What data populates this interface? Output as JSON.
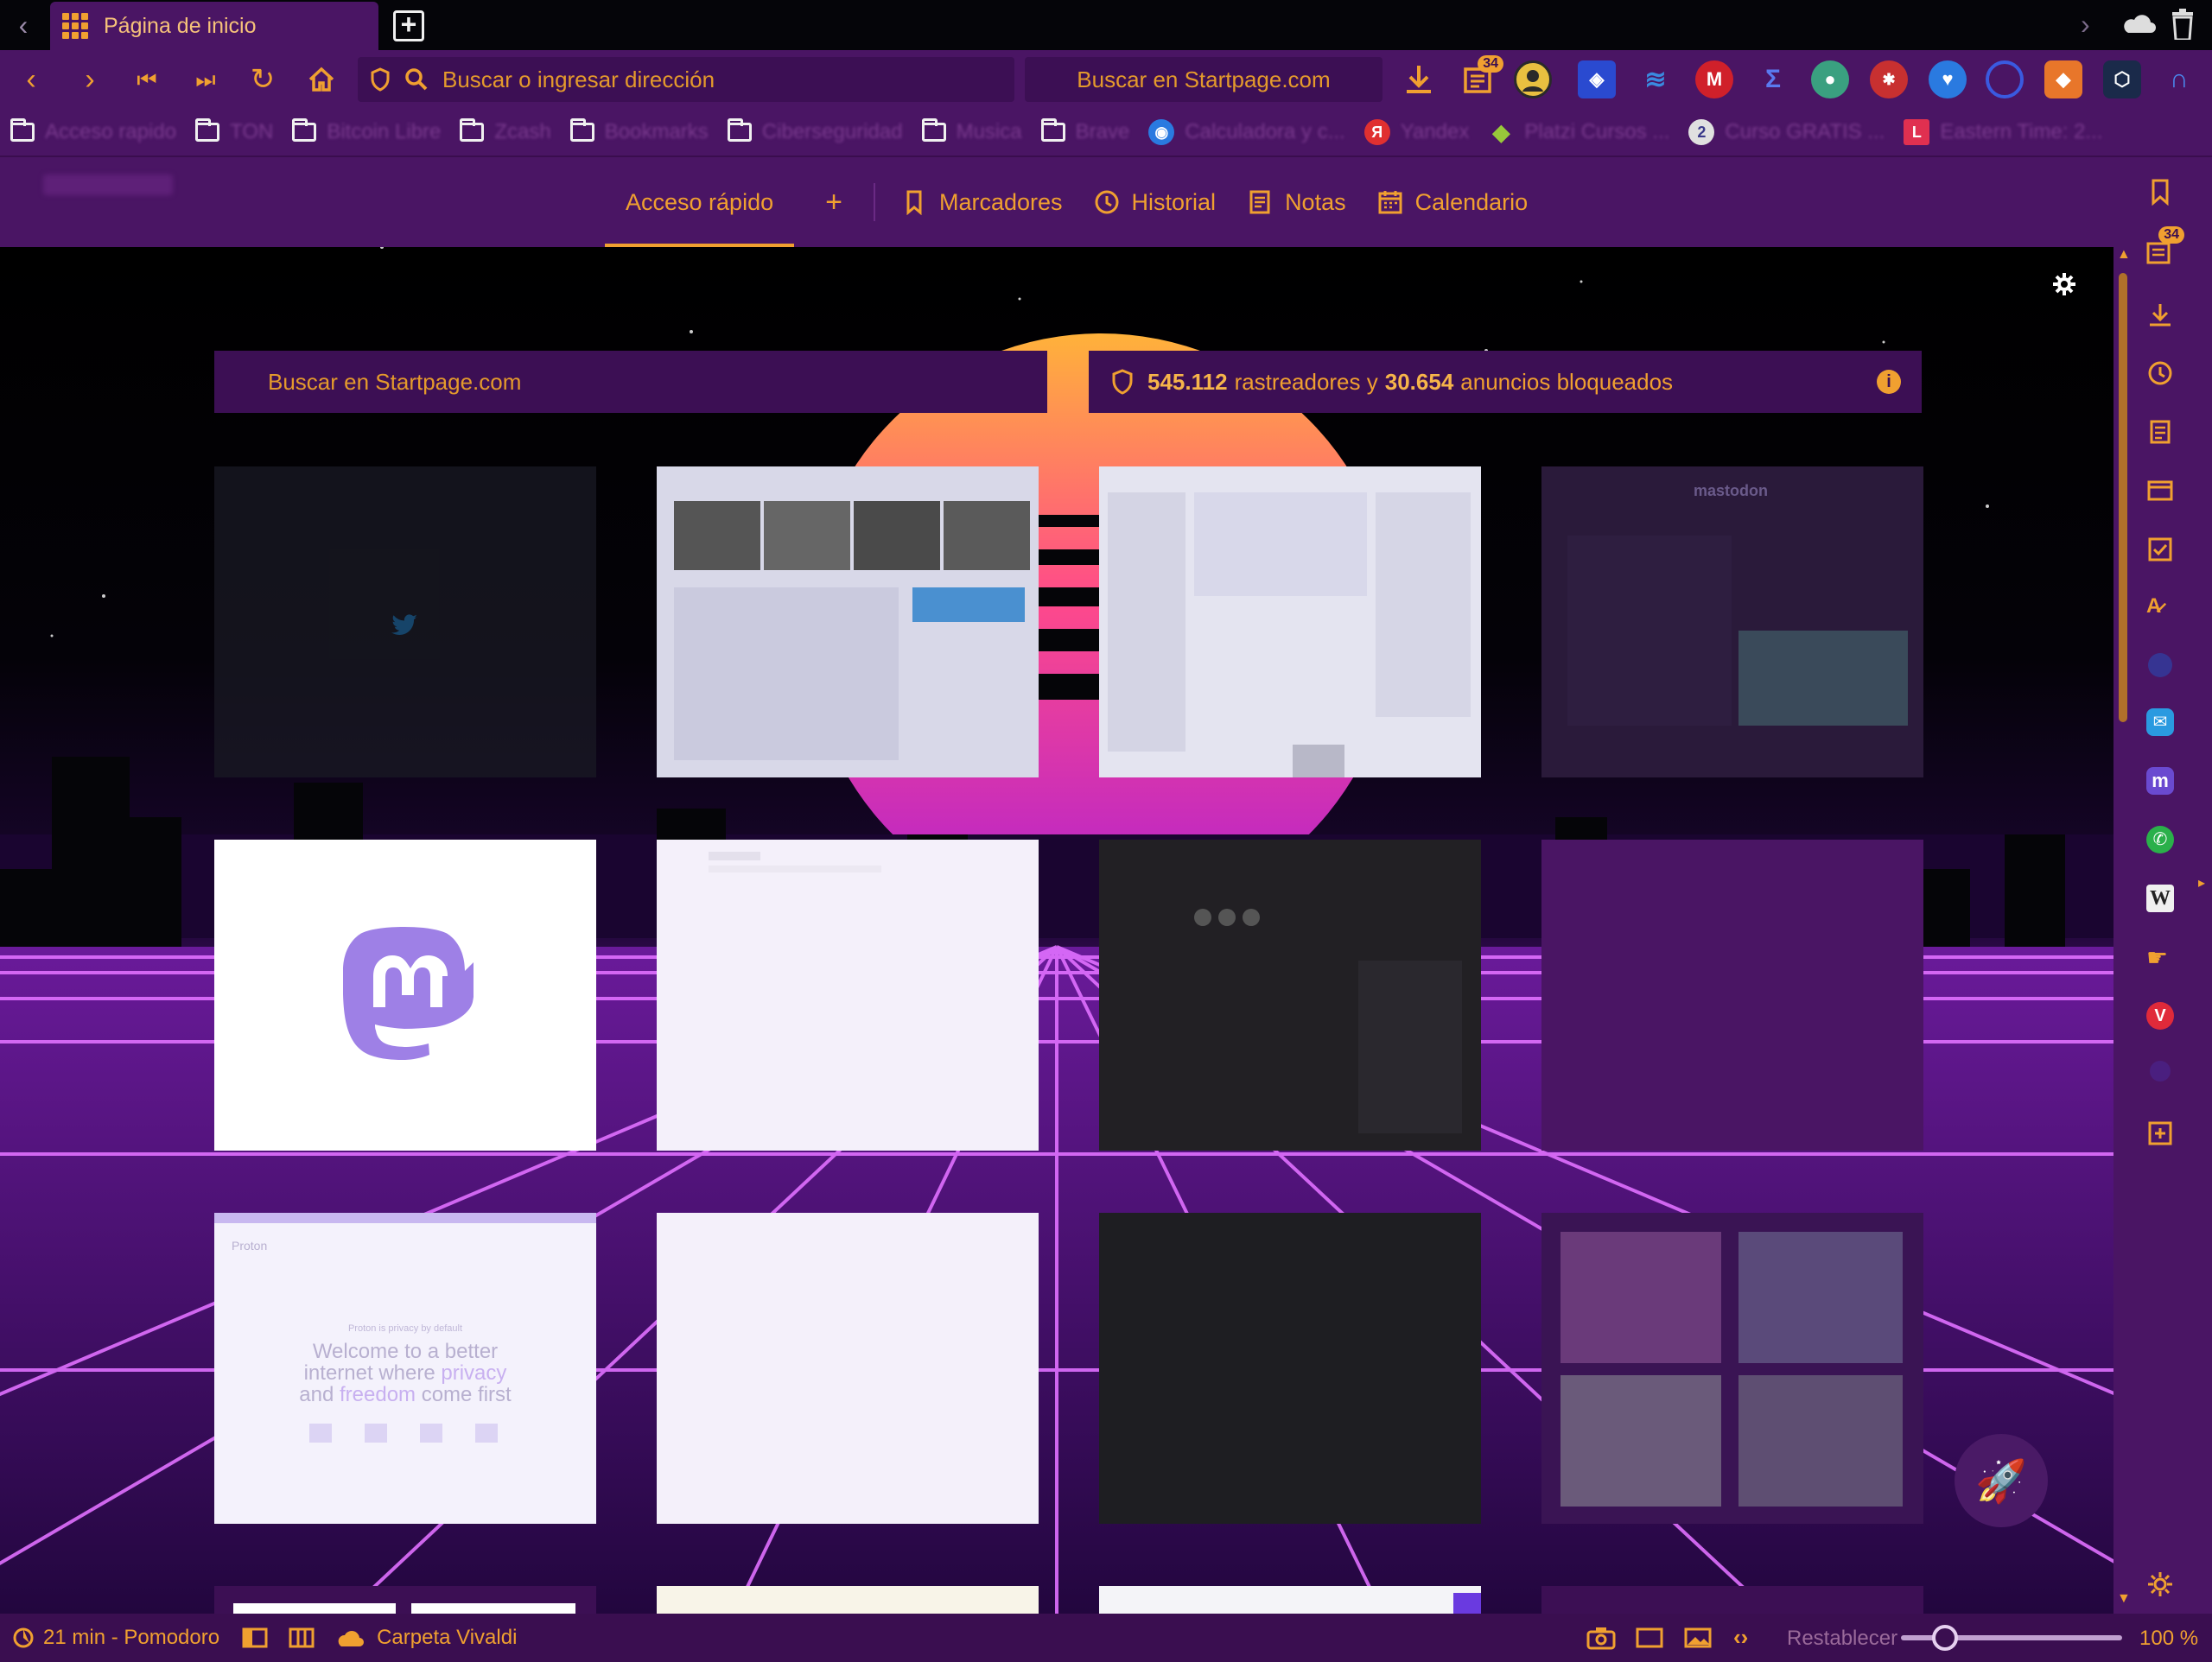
{
  "tab": {
    "title": "Página de inicio"
  },
  "addressbar": {
    "url_placeholder": "Buscar o ingresar dirección",
    "search_placeholder": "Buscar en Startpage.com",
    "notes_badge": "34"
  },
  "bookmarks": [
    {
      "type": "folder",
      "label": "Acceso rapido"
    },
    {
      "type": "folder",
      "label": "TON"
    },
    {
      "type": "folder",
      "label": "Bitcoin Libre"
    },
    {
      "type": "folder",
      "label": "Zcash"
    },
    {
      "type": "folder",
      "label": "Bookmarks"
    },
    {
      "type": "folder",
      "label": "Ciberseguridad"
    },
    {
      "type": "folder",
      "label": "Musica"
    },
    {
      "type": "folder",
      "label": "Brave"
    },
    {
      "type": "site",
      "label": "Calculadora y c...",
      "color": "#2a7ae0",
      "glyph": "◉"
    },
    {
      "type": "site",
      "label": "Yandex",
      "color": "#e03030",
      "glyph": "Я"
    },
    {
      "type": "site",
      "label": "Platzi Cursos ...",
      "color": "#98c83a",
      "glyph": "◆"
    },
    {
      "type": "site",
      "label": "Curso GRATIS ...",
      "color": "#e0e0e0",
      "glyph": "2"
    },
    {
      "type": "site",
      "label": "Eastern Time: 2...",
      "color": "#e03050",
      "glyph": "L"
    }
  ],
  "startpage": {
    "tabs": {
      "quick_access": "Acceso rápido",
      "add": "+",
      "bookmarks": "Marcadores",
      "history": "Historial",
      "notes": "Notas",
      "calendar": "Calendario"
    },
    "search_placeholder": "Buscar en Startpage.com",
    "tracker": {
      "trackers": "545.112",
      "trackers_text": "rastreadores y",
      "ads": "30.654",
      "ads_text": "anuncios bloqueados"
    },
    "dial_texts": {
      "mastodon_logo": "mastodon",
      "proton_brand": "Proton",
      "proton_tagline": "Proton is privacy by default",
      "proton_headline_1": "Welcome to a better",
      "proton_headline_2a": "internet where ",
      "proton_headline_2b": "privacy",
      "proton_headline_3a": "and ",
      "proton_headline_3b": "freedom",
      "proton_headline_3c": " come first"
    }
  },
  "panel": {
    "notes_badge": "34"
  },
  "statusbar": {
    "pomodoro": "21 min - Pomodoro",
    "cloud_folder": "Carpeta Vivaldi",
    "reset": "Restablecer",
    "zoom": "100 %",
    "zoom_fraction": 0.2
  },
  "colors": {
    "accent": "#f0a030",
    "chrome": "#4a1564",
    "field": "#3c0f54"
  }
}
